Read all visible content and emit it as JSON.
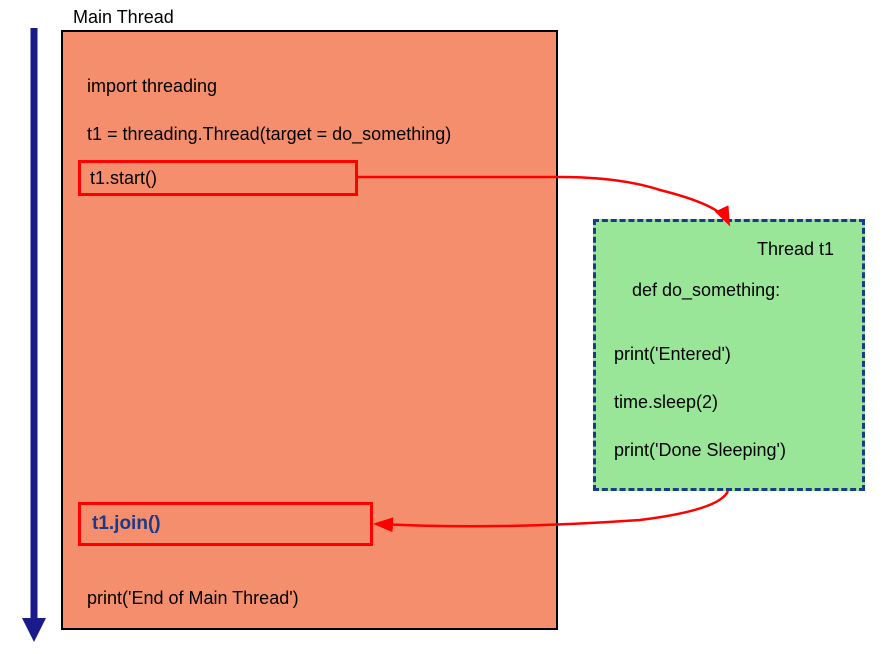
{
  "mainThread": {
    "label": "Main Thread",
    "code": {
      "line1": "import threading",
      "line2": "t1 = threading.Thread(target = do_something)",
      "line3": "t1.start()",
      "line4": "t1.join()",
      "line5": "print('End of Main Thread')"
    }
  },
  "threadT1": {
    "label": "Thread t1",
    "code": {
      "line1": "def do_something:",
      "line2": "print('Entered')",
      "line3": "time.sleep(2)",
      "line4": "print('Done Sleeping')"
    }
  }
}
